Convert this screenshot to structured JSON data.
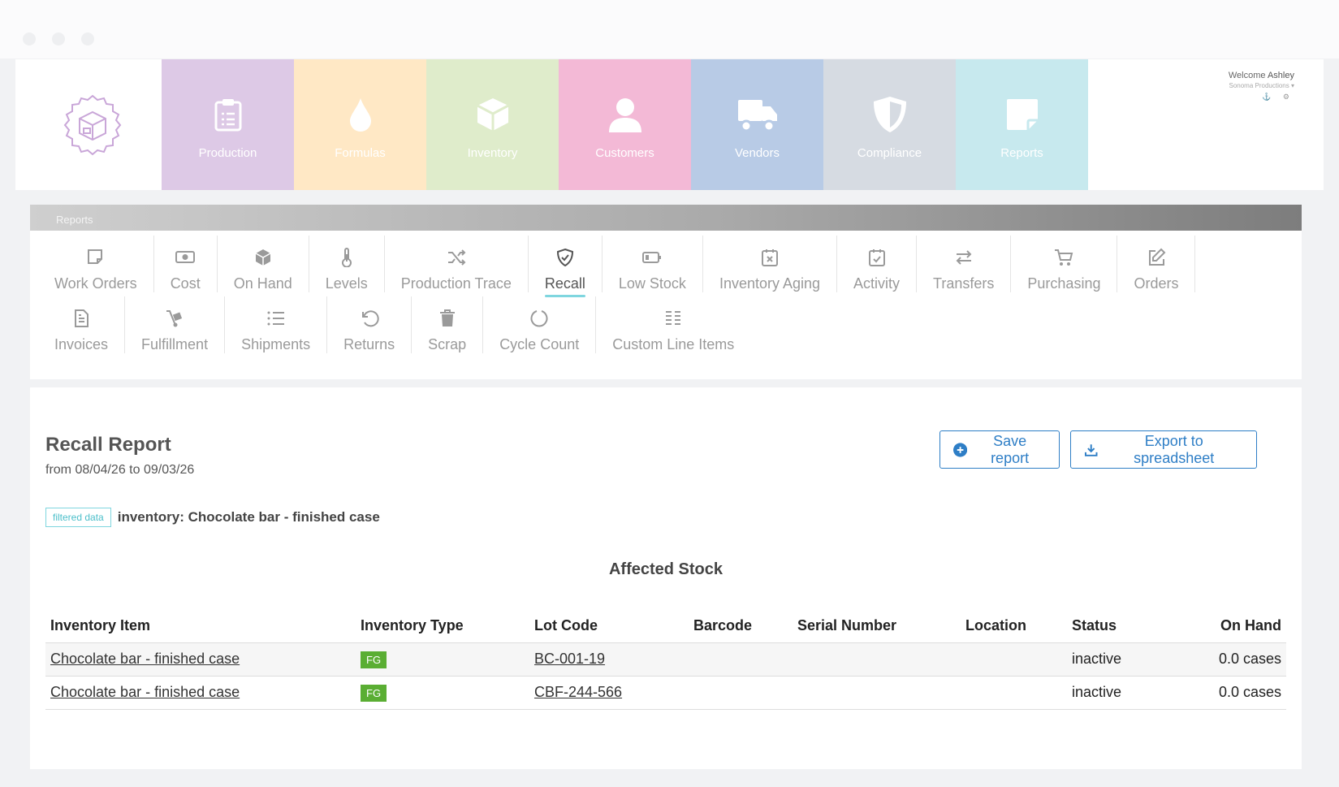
{
  "header": {
    "welcome_prefix": "Welcome",
    "user_name": "Ashley",
    "company": "Sonoma Productions",
    "mini_icons": "⚓ ⚙"
  },
  "modules": [
    {
      "label": "Production",
      "color": "#ddc9e6",
      "icon": "clipboard-icon"
    },
    {
      "label": "Formulas",
      "color": "#ffe8c5",
      "icon": "droplet-icon"
    },
    {
      "label": "Inventory",
      "color": "#dfeccb",
      "icon": "box-icon"
    },
    {
      "label": "Customers",
      "color": "#f3b9d6",
      "icon": "person-icon"
    },
    {
      "label": "Vendors",
      "color": "#b8cbe6",
      "icon": "truck-icon"
    },
    {
      "label": "Compliance",
      "color": "#d6dbe2",
      "icon": "shield-icon"
    },
    {
      "label": "Reports",
      "color": "#c7e9ee",
      "icon": "note-icon"
    }
  ],
  "reports_nav": {
    "header": "Reports",
    "row1": [
      {
        "label": "Work Orders",
        "icon": "note-icon"
      },
      {
        "label": "Cost",
        "icon": "money-icon"
      },
      {
        "label": "On Hand",
        "icon": "cube-icon"
      },
      {
        "label": "Levels",
        "icon": "thermometer-icon"
      },
      {
        "label": "Production Trace",
        "icon": "shuffle-icon"
      },
      {
        "label": "Recall",
        "icon": "shield-check-icon",
        "active": true
      },
      {
        "label": "Low Stock",
        "icon": "battery-low-icon"
      },
      {
        "label": "Inventory Aging",
        "icon": "calendar-x-icon"
      },
      {
        "label": "Activity",
        "icon": "calendar-check-icon"
      },
      {
        "label": "Transfers",
        "icon": "transfer-arrows-icon"
      },
      {
        "label": "Purchasing",
        "icon": "cart-icon"
      },
      {
        "label": "Orders",
        "icon": "edit-icon"
      }
    ],
    "row2": [
      {
        "label": "Invoices",
        "icon": "document-icon"
      },
      {
        "label": "Fulfillment",
        "icon": "dolly-icon"
      },
      {
        "label": "Shipments",
        "icon": "list-icon"
      },
      {
        "label": "Returns",
        "icon": "undo-icon"
      },
      {
        "label": "Scrap",
        "icon": "trash-icon"
      },
      {
        "label": "Cycle Count",
        "icon": "circle-notch-icon"
      },
      {
        "label": "Custom Line Items",
        "icon": "columns-list-icon"
      }
    ]
  },
  "report": {
    "title": "Recall Report",
    "range": "from 08/04/26 to 09/03/26",
    "save_label": "Save report",
    "export_label": "Export to spreadsheet",
    "filter_tag": "filtered data",
    "filter_text": "inventory: Chocolate bar - finished case",
    "table_title": "Affected Stock",
    "columns": [
      "Inventory Item",
      "Inventory Type",
      "Lot Code",
      "Barcode",
      "Serial Number",
      "Location",
      "Status",
      "On Hand"
    ],
    "rows": [
      {
        "item": "Chocolate bar - finished case",
        "type": "FG",
        "lot": "BC-001-19",
        "barcode": "",
        "serial": "",
        "location": "",
        "status": "inactive",
        "on_hand": "0.0 cases"
      },
      {
        "item": "Chocolate bar - finished case",
        "type": "FG",
        "lot": "CBF-244-566",
        "barcode": "",
        "serial": "",
        "location": "",
        "status": "inactive",
        "on_hand": "0.0 cases"
      }
    ]
  },
  "colors": {
    "accent_blue": "#2e7ec6",
    "active_underline": "#7fd6df",
    "badge_green": "#5aae33",
    "logo_purple": "#c9a6d8"
  }
}
